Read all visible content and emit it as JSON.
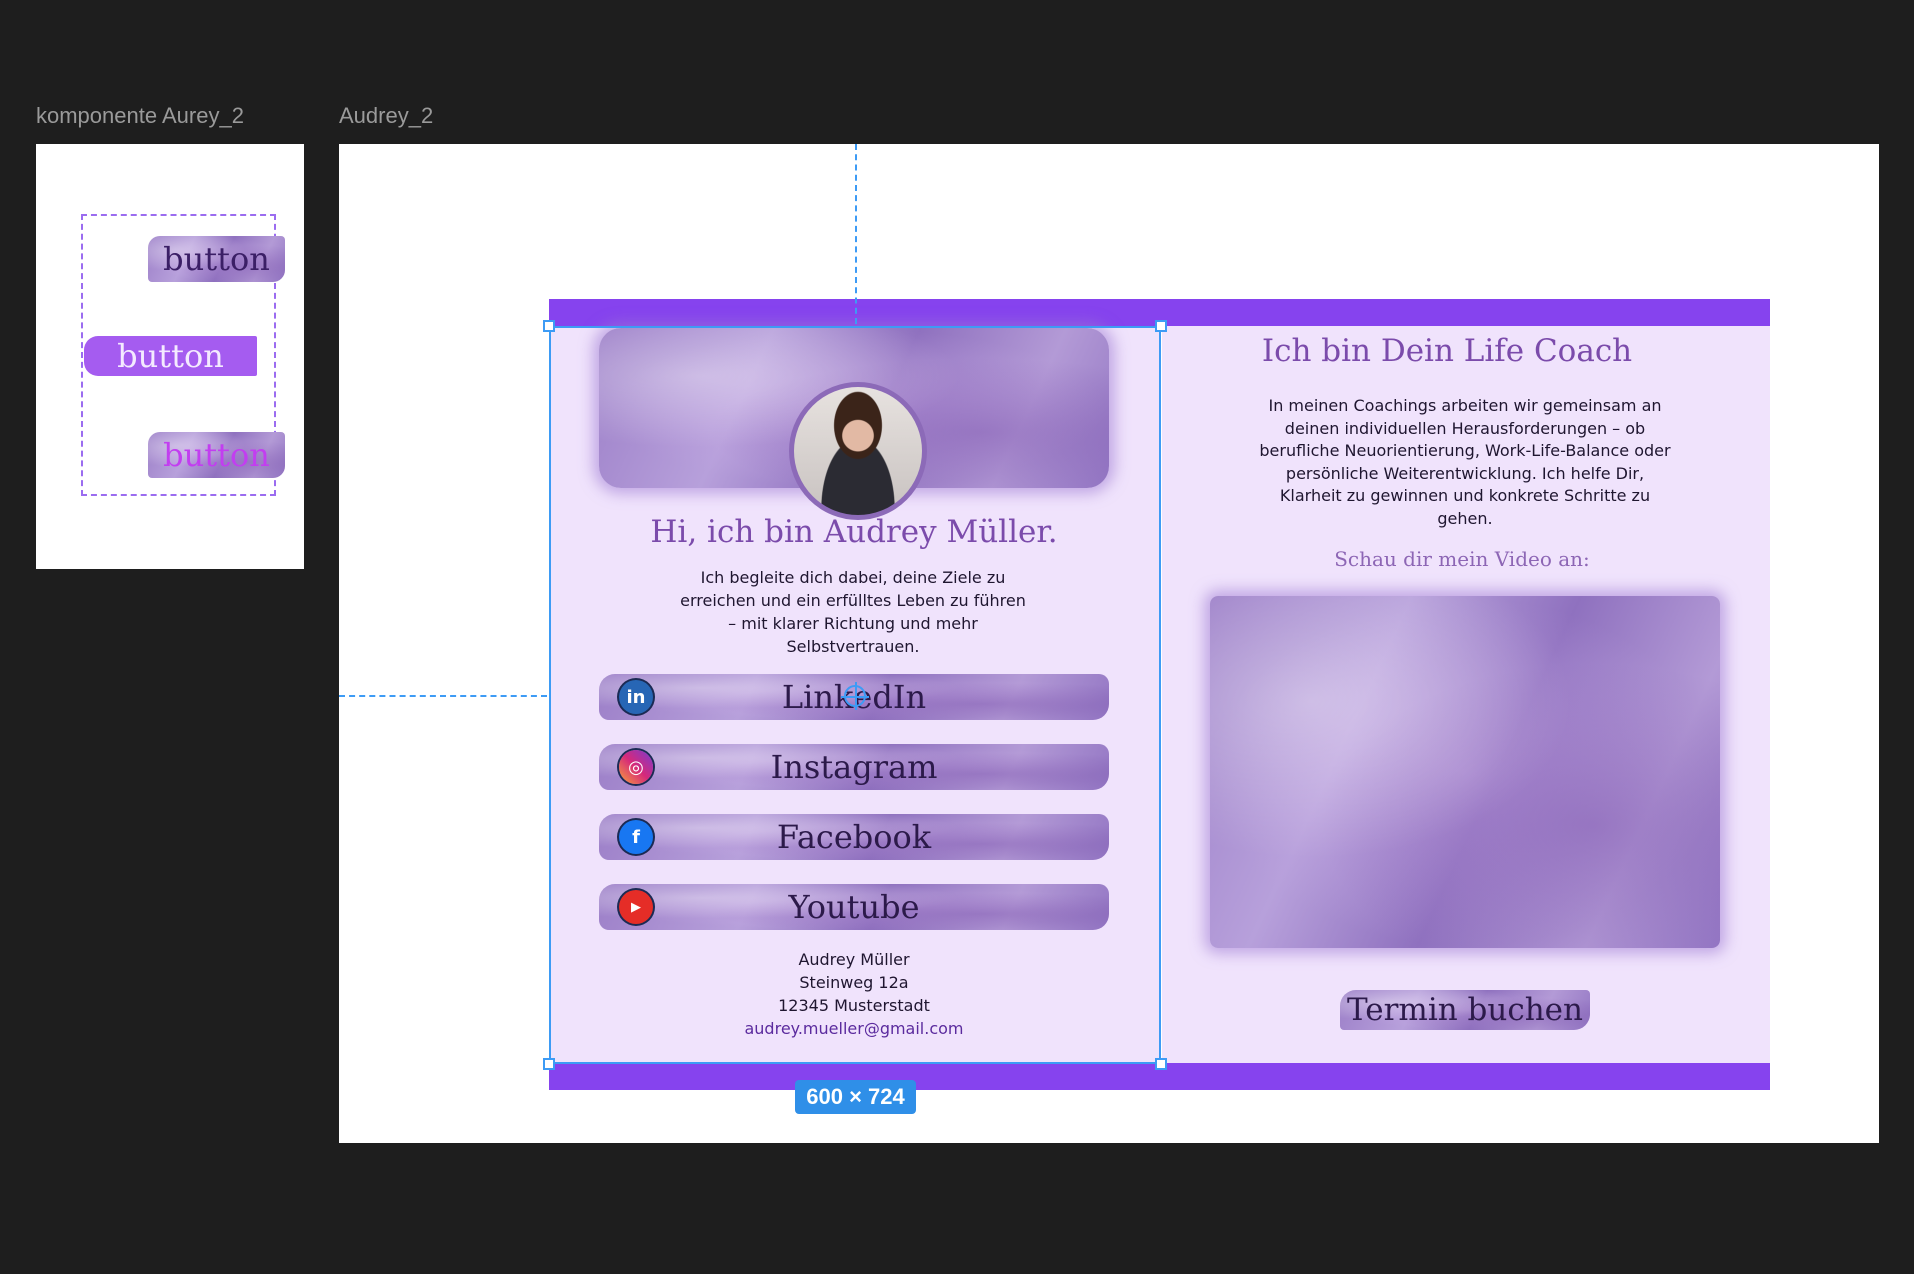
{
  "frames": {
    "component_label": "komponente Aurey_2",
    "design_label": "Audrey_2"
  },
  "component": {
    "variants": [
      {
        "label": "button"
      },
      {
        "label": "button"
      },
      {
        "label": "button"
      }
    ]
  },
  "profile": {
    "greeting": "Hi, ich bin Audrey Müller.",
    "intro": "Ich begleite dich dabei, deine Ziele zu erreichen und ein erfülltes Leben zu führen – mit klarer Richtung und mehr Selbstvertrauen.",
    "social": [
      {
        "label": "LinkedIn",
        "icon": "linkedin-icon",
        "color": "#2766b5"
      },
      {
        "label": "Instagram",
        "icon": "instagram-icon",
        "color": "#d6297a"
      },
      {
        "label": "Facebook",
        "icon": "facebook-icon",
        "color": "#1877f2"
      },
      {
        "label": "Youtube",
        "icon": "youtube-icon",
        "color": "#e52d27"
      }
    ],
    "address": {
      "name": "Audrey Müller",
      "street": "Steinweg 12a",
      "city": "12345 Musterstadt",
      "email": "audrey.mueller@gmail.com"
    }
  },
  "coach": {
    "title": "Ich bin Dein Life Coach",
    "description": "In meinen Coachings arbeiten wir gemeinsam an deinen individuellen Herausforderungen – ob berufliche Neuorientierung, Work-Life-Balance oder persönliche Weiterentwicklung. Ich helfe Dir, Klarheit zu gewinnen und konkrete Schritte zu gehen.",
    "video_prompt": "Schau dir mein Video an:",
    "cta": "Termin buchen"
  },
  "selection": {
    "size": "600 × 724"
  },
  "colors": {
    "accent": "#8643ee",
    "page_bg": "#f0e3fc",
    "selection": "#3d9bf5"
  }
}
